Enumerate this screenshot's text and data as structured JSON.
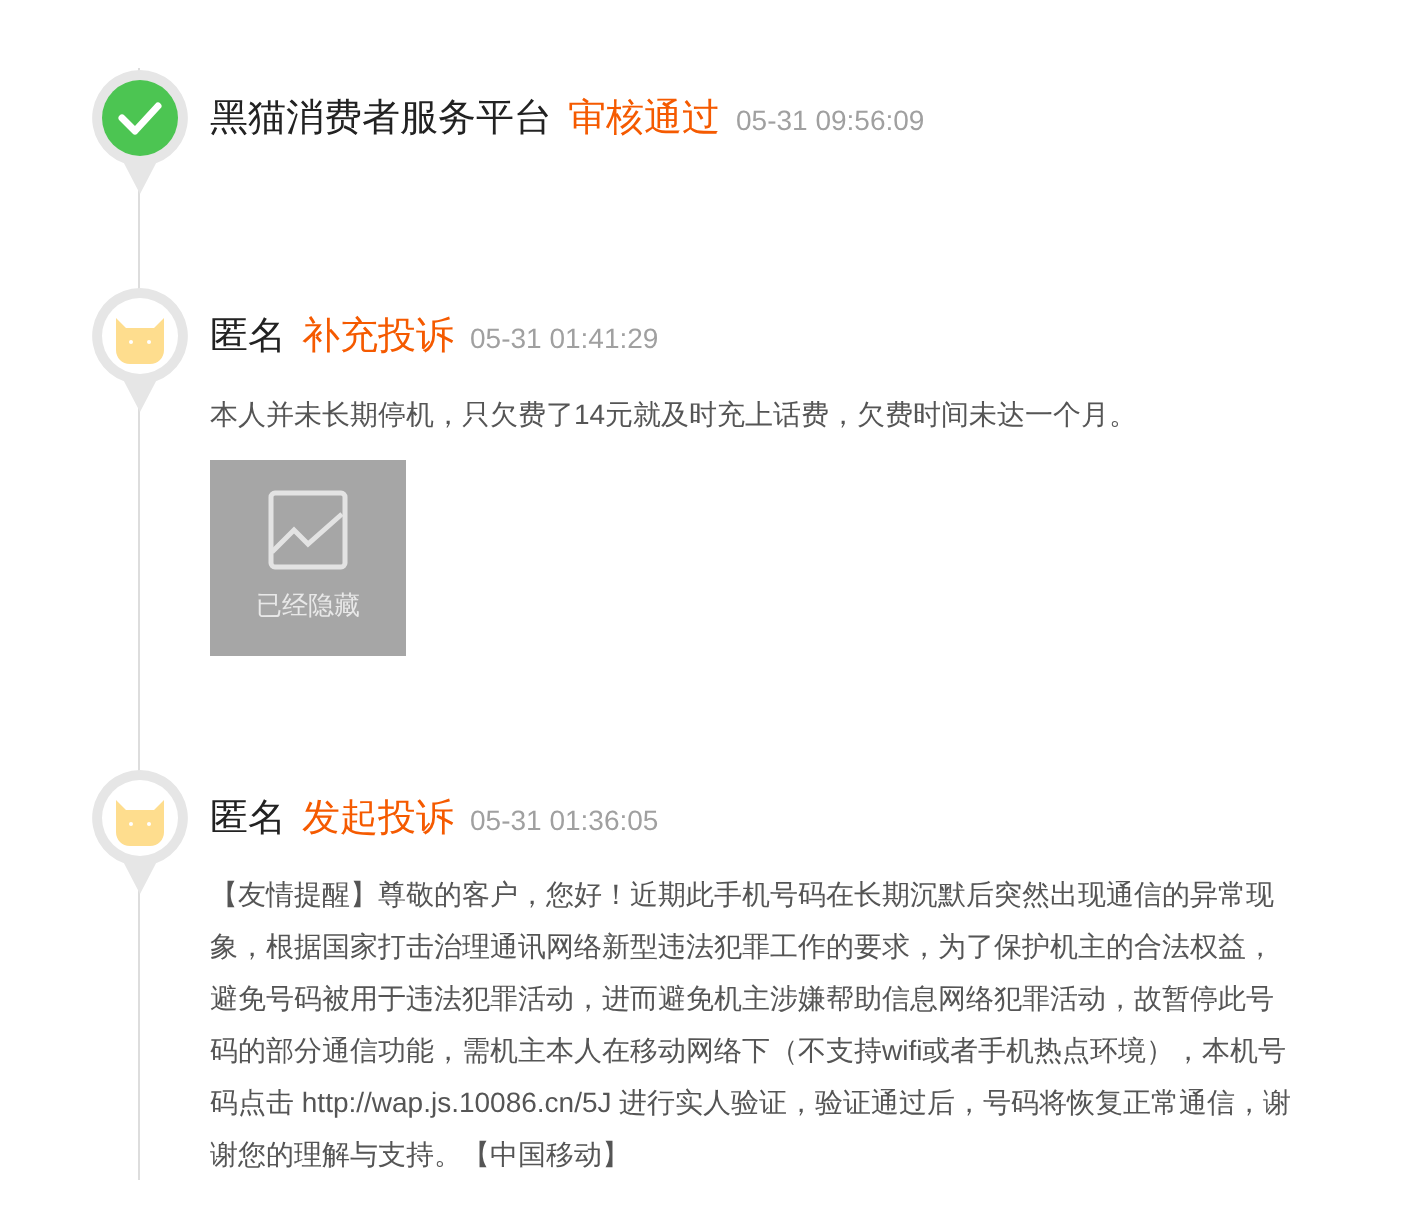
{
  "timeline": [
    {
      "kind": "check",
      "author": "黑猫消费者服务平台",
      "action": "审核通过",
      "time": "05-31 09:56:09"
    },
    {
      "kind": "cat",
      "author": "匿名",
      "action": "补充投诉",
      "time": "05-31 01:41:29",
      "text": "本人并未长期停机，只欠费了14元就及时充上话费，欠费时间未达一个月。",
      "attachments": [
        {
          "label": "已经隐藏"
        }
      ]
    },
    {
      "kind": "cat",
      "author": "匿名",
      "action": "发起投诉",
      "time": "05-31 01:36:05",
      "text": "【友情提醒】尊敬的客户，您好！近期此手机号码在长期沉默后突然出现通信的异常现象，根据国家打击治理通讯网络新型违法犯罪工作的要求，为了保护机主的合法权益，避免号码被用于违法犯罪活动，进而避免机主涉嫌帮助信息网络犯罪活动，故暂停此号码的部分通信功能，需机主本人在移动网络下（不支持wifi或者手机热点环境），本机号码点击 http://wap.js.10086.cn/5J 进行实人验证，验证通过后，号码将恢复正常通信，谢谢您的理解与支持。【中国移动】"
    }
  ]
}
